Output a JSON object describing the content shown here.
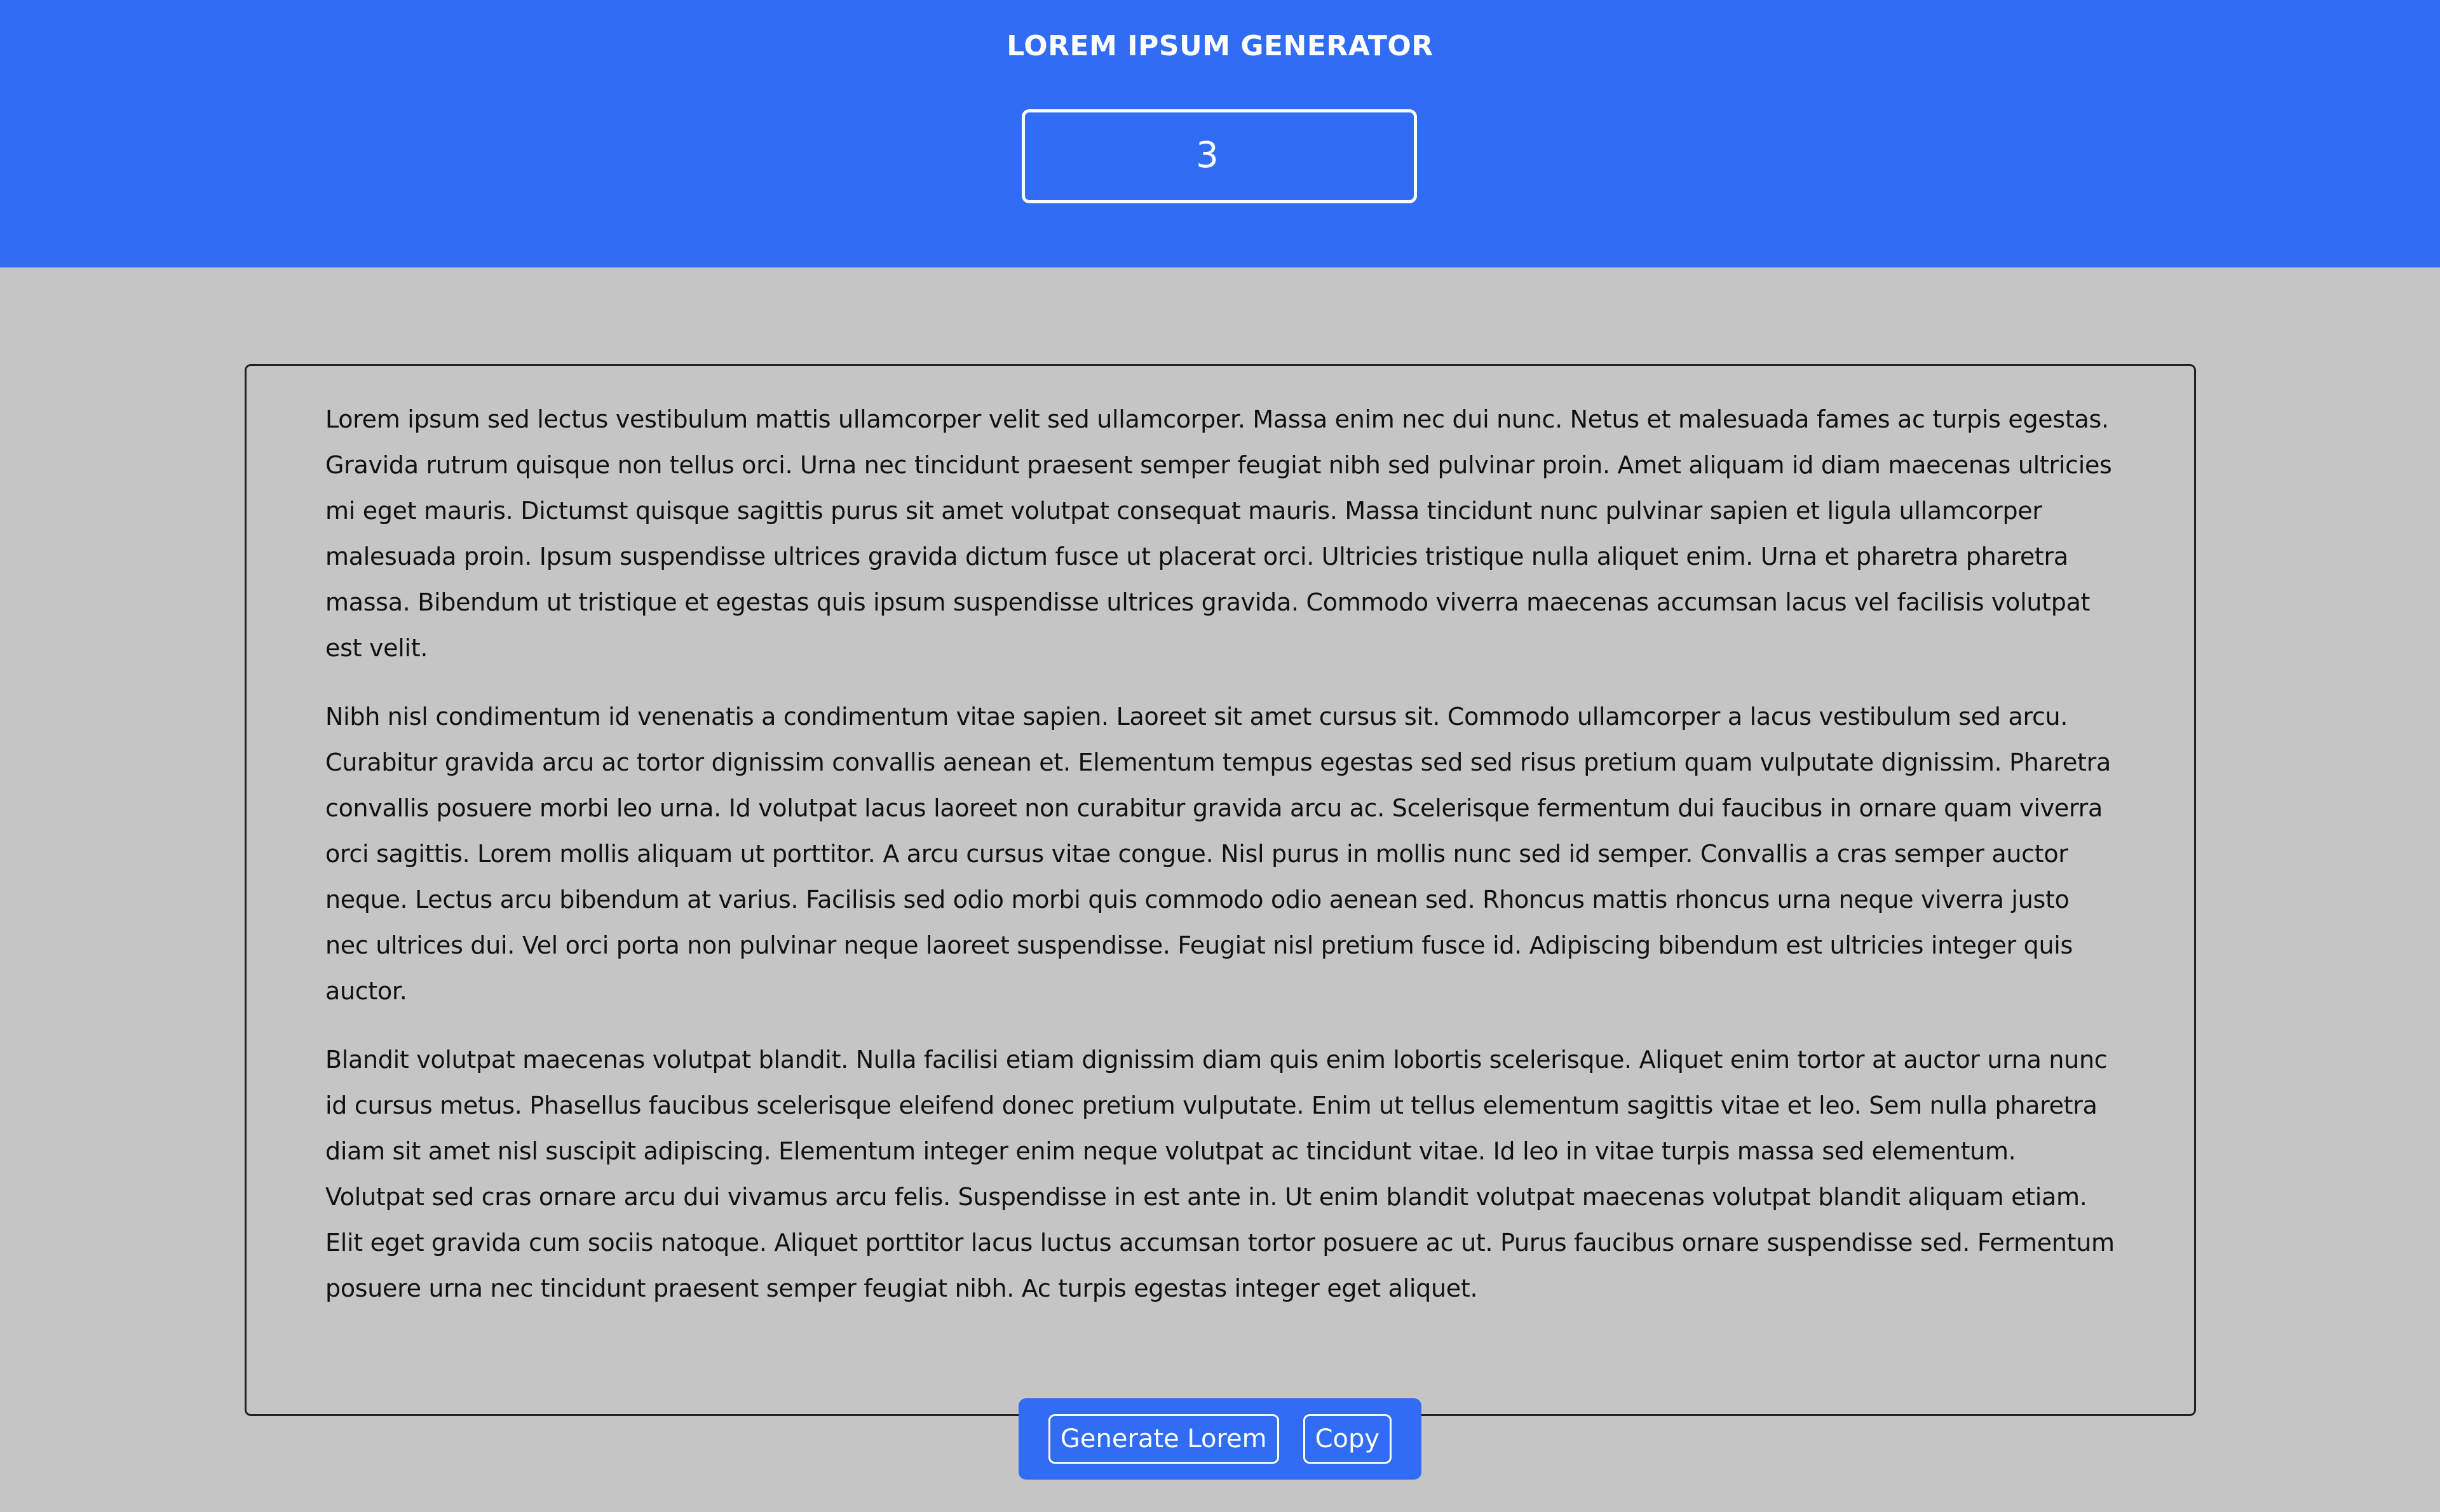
{
  "header": {
    "title": "LOREM IPSUM GENERATOR",
    "paragraph_count": "3"
  },
  "content": {
    "paragraphs": [
      "Lorem ipsum sed lectus vestibulum mattis ullamcorper velit sed ullamcorper. Massa enim nec dui nunc. Netus et malesuada fames ac turpis egestas. Gravida rutrum quisque non tellus orci. Urna nec tincidunt praesent semper feugiat nibh sed pulvinar proin. Amet aliquam id diam maecenas ultricies mi eget mauris. Dictumst quisque sagittis purus sit amet volutpat consequat mauris. Massa tincidunt nunc pulvinar sapien et ligula ullamcorper malesuada proin. Ipsum suspendisse ultrices gravida dictum fusce ut placerat orci. Ultricies tristique nulla aliquet enim. Urna et pharetra pharetra massa. Bibendum ut tristique et egestas quis ipsum suspendisse ultrices gravida. Commodo viverra maecenas accumsan lacus vel facilisis volutpat est velit.",
      "Nibh nisl condimentum id venenatis a condimentum vitae sapien. Laoreet sit amet cursus sit. Commodo ullamcorper a lacus vestibulum sed arcu. Curabitur gravida arcu ac tortor dignissim convallis aenean et. Elementum tempus egestas sed sed risus pretium quam vulputate dignissim. Pharetra convallis posuere morbi leo urna. Id volutpat lacus laoreet non curabitur gravida arcu ac. Scelerisque fermentum dui faucibus in ornare quam viverra orci sagittis. Lorem mollis aliquam ut porttitor. A arcu cursus vitae congue. Nisl purus in mollis nunc sed id semper. Convallis a cras semper auctor neque. Lectus arcu bibendum at varius. Facilisis sed odio morbi quis commodo odio aenean sed. Rhoncus mattis rhoncus urna neque viverra justo nec ultrices dui. Vel orci porta non pulvinar neque laoreet suspendisse. Feugiat nisl pretium fusce id. Adipiscing bibendum est ultricies integer quis auctor.",
      "Blandit volutpat maecenas volutpat blandit. Nulla facilisi etiam dignissim diam quis enim lobortis scelerisque. Aliquet enim tortor at auctor urna nunc id cursus metus. Phasellus faucibus scelerisque eleifend donec pretium vulputate. Enim ut tellus elementum sagittis vitae et leo. Sem nulla pharetra diam sit amet nisl suscipit adipiscing. Elementum integer enim neque volutpat ac tincidunt vitae. Id leo in vitae turpis massa sed elementum. Volutpat sed cras ornare arcu dui vivamus arcu felis. Suspendisse in est ante in. Ut enim blandit volutpat maecenas volutpat blandit aliquam etiam. Elit eget gravida cum sociis natoque. Aliquet porttitor lacus luctus accumsan tortor posuere ac ut. Purus faucibus ornare suspendisse sed. Fermentum posuere urna nec tincidunt praesent semper feugiat nibh. Ac turpis egestas integer eget aliquet."
    ]
  },
  "actions": {
    "generate_label": "Generate Lorem",
    "copy_label": "Copy"
  },
  "colors": {
    "accent": "#316cf4",
    "background": "#c5c5c5",
    "text": "#111111"
  }
}
